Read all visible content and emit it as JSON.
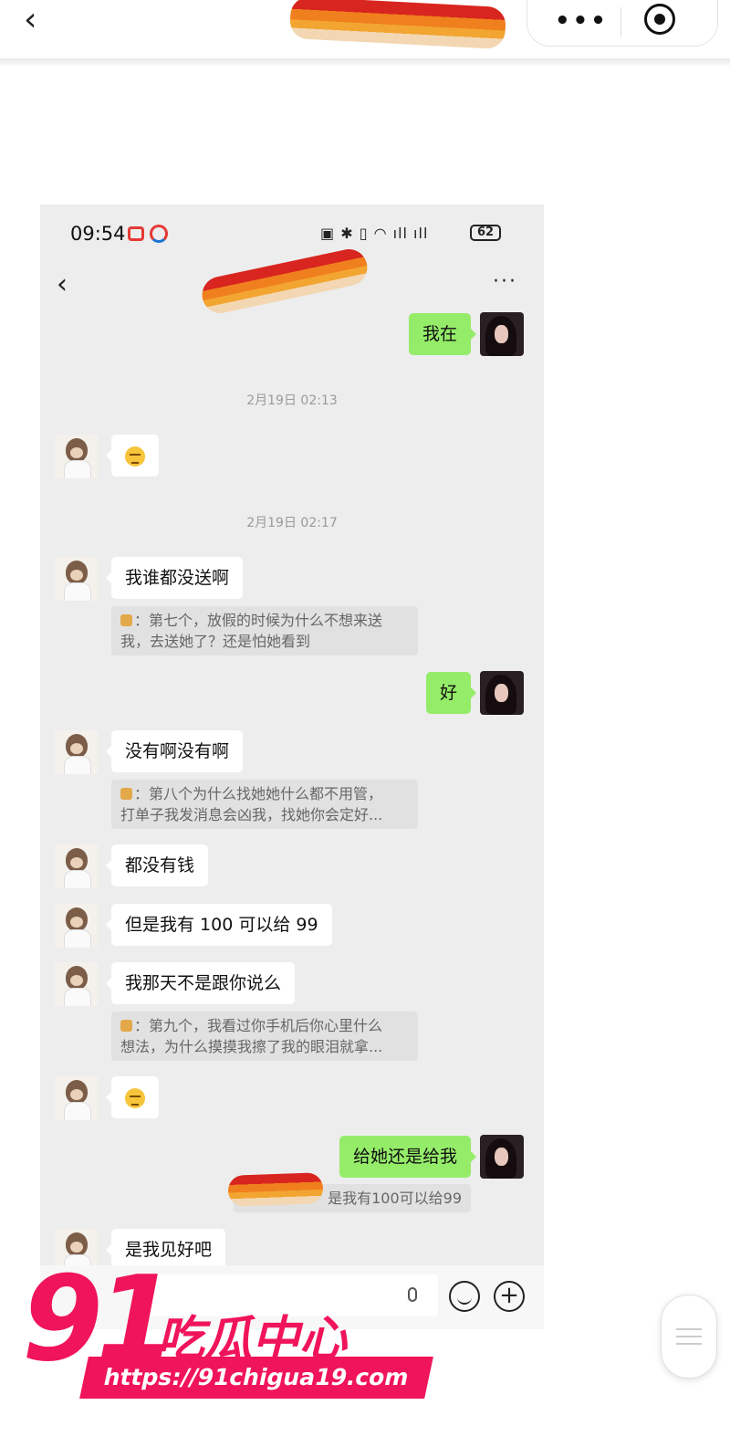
{
  "outer_app": {
    "back_symbol": "‹",
    "menu_symbol": "•••"
  },
  "phone_status": {
    "time": "09:54",
    "battery": "62"
  },
  "chat_header": {
    "back_symbol": "‹",
    "more_symbol": "···"
  },
  "messages": {
    "m1": "我在",
    "ts1": "2月19日 02:13",
    "ts2": "2月19日 02:17",
    "m3": "我谁都没送啊",
    "q1_line1": "：第七个，放假的时候为什么不想来送",
    "q1_line2": "我，去送她了？还是怕她看到",
    "m4": "好",
    "m5": "没有啊没有啊",
    "q2_line1": "：第八个为什么找她她什么都不用管，",
    "q2_line2": "打单子我发消息会凶我，找她你会定好...",
    "m6": "都没有钱",
    "m7": "但是我有 100 可以给 99",
    "m8": "我那天不是跟你说么",
    "q3_line1": "：第九个，我看过你手机后你心里什么",
    "q3_line2": "想法，为什么摸摸我擦了我的眼泪就拿...",
    "m10": "给她还是给我",
    "q4": "是我有100可以给99",
    "m11": "是我见好吧"
  },
  "watermark": {
    "logo_number": "91",
    "logo_name": "吃瓜中心",
    "url": "https://91chigua19.com"
  },
  "colors": {
    "accent_pink": "#f0145a",
    "bubble_green": "#95ec69",
    "chat_bg": "#ededed"
  }
}
